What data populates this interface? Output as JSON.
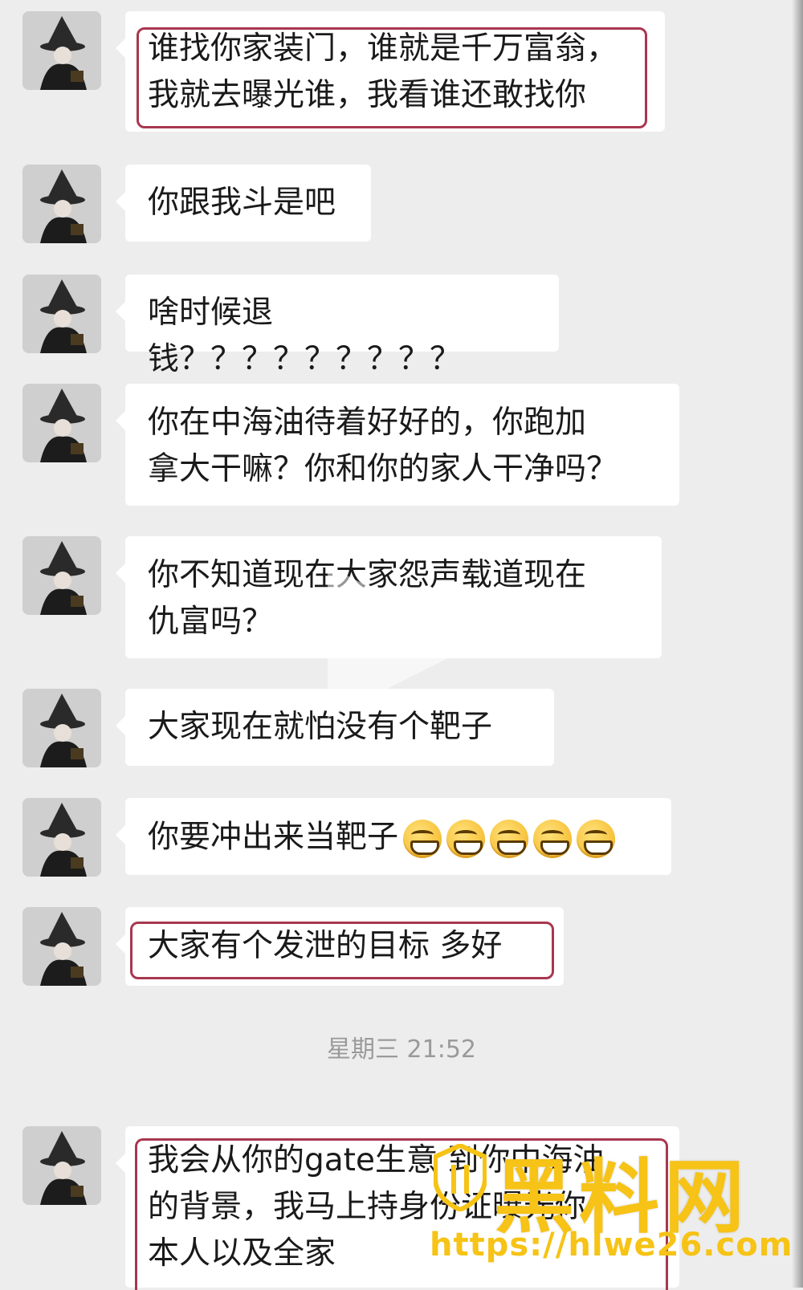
{
  "messages": [
    {
      "lines": [
        "谁找你家装门，谁就是千万富翁，",
        "我就去曝光谁，我看谁还敢找你"
      ]
    },
    {
      "lines": [
        "你跟我斗是吧"
      ]
    },
    {
      "lines": [
        "啥时候退钱？？？？？？？？？"
      ]
    },
    {
      "lines": [
        "你在中海油待着好好的，你跑加",
        "拿大干嘛？你和你的家人干净吗？"
      ]
    },
    {
      "lines": [
        "你不知道现在大家怨声载道现在",
        "仇富吗？"
      ]
    },
    {
      "lines": [
        "大家现在就怕没有个靶子"
      ]
    },
    {
      "lines": [
        "你要冲出来当靶子"
      ],
      "emoji": "grinning-face-icon",
      "emoji_count": 5
    },
    {
      "lines": [
        "大家有个发泄的目标 多好"
      ]
    },
    {
      "lines": [
        "我会从你的gate生意 到你中海油",
        "的背景，我马上持身份证曝光你",
        "本人以及全家"
      ]
    }
  ],
  "timestamp": "星期三 21:52",
  "watermark": {
    "text": "黑料网",
    "url": "https://hlwe26.com",
    "color": "#f6c316"
  },
  "colors": {
    "background": "#ededed",
    "bubble": "#ffffff",
    "highlight_border": "#a8374f"
  }
}
